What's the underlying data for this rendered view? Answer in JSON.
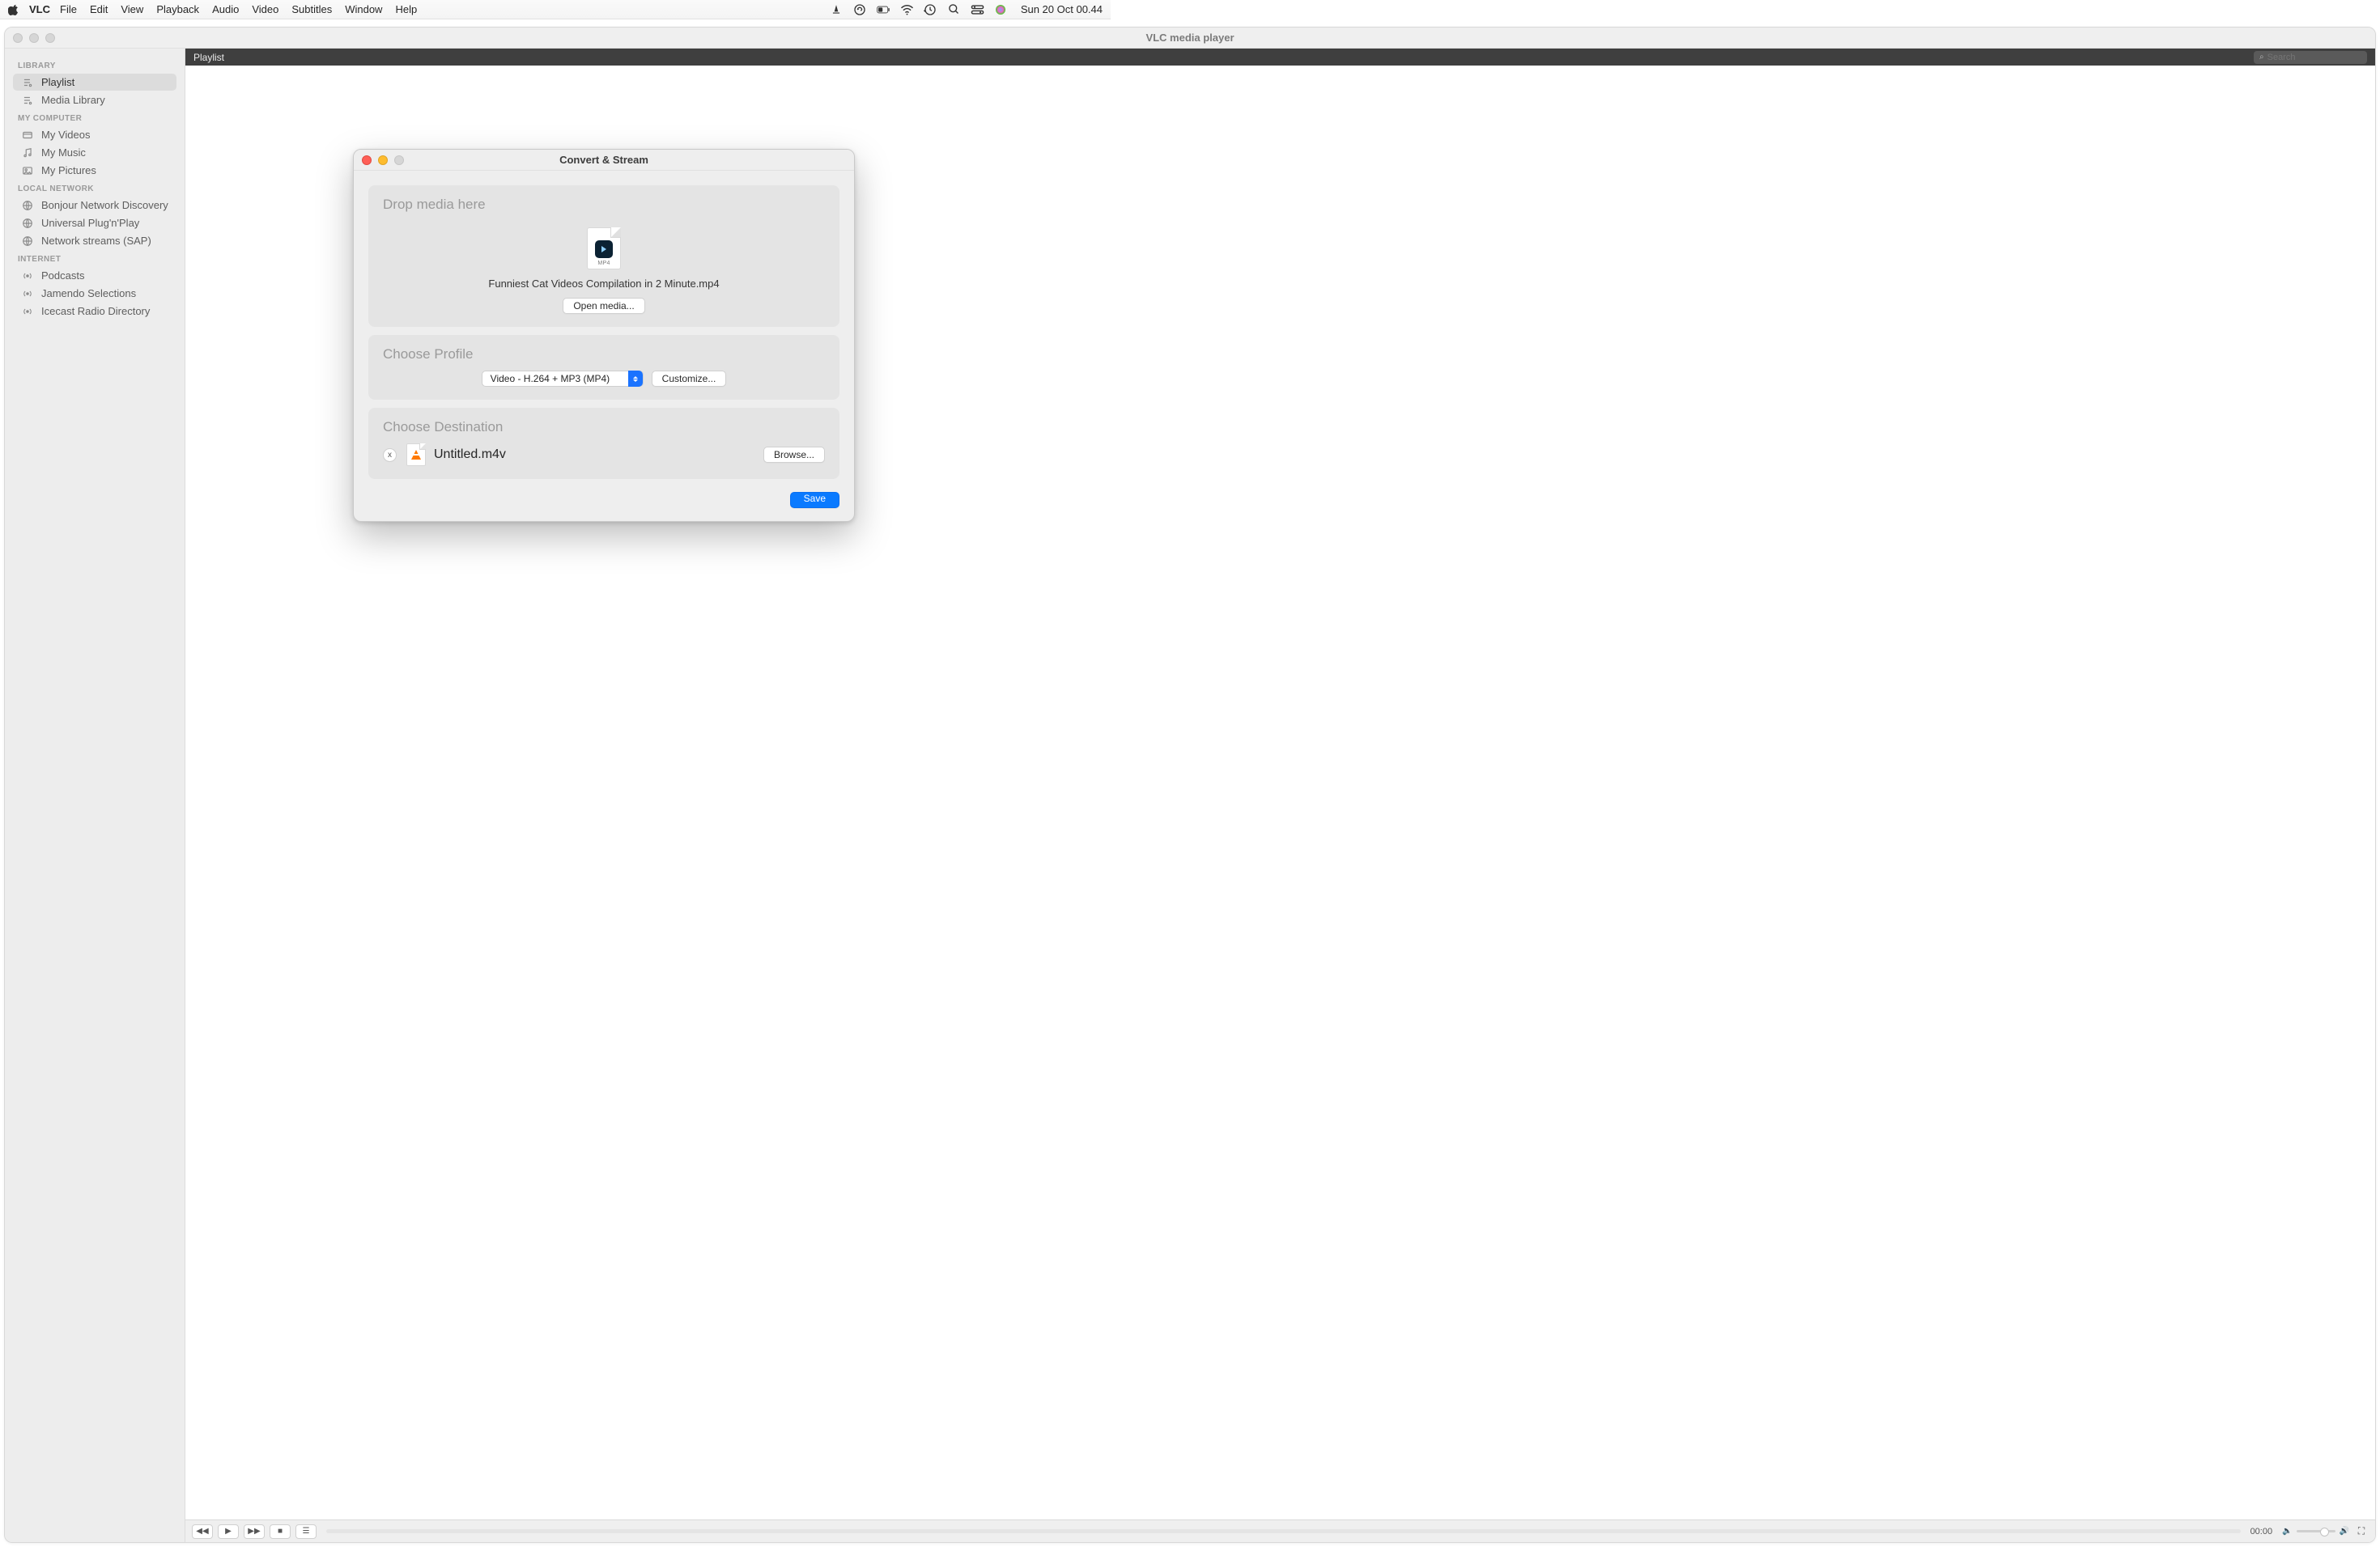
{
  "menubar": {
    "app": "VLC",
    "items": [
      "File",
      "Edit",
      "View",
      "Playback",
      "Audio",
      "Video",
      "Subtitles",
      "Window",
      "Help"
    ],
    "clock": "Sun 20 Oct  00.44"
  },
  "window": {
    "title": "VLC media player"
  },
  "sidebar": {
    "groups": [
      {
        "label": "LIBRARY",
        "items": [
          {
            "label": "Playlist",
            "icon": "playlist",
            "active": true
          },
          {
            "label": "Media Library",
            "icon": "playlist"
          }
        ]
      },
      {
        "label": "MY COMPUTER",
        "items": [
          {
            "label": "My Videos",
            "icon": "video"
          },
          {
            "label": "My Music",
            "icon": "music"
          },
          {
            "label": "My Pictures",
            "icon": "pictures"
          }
        ]
      },
      {
        "label": "LOCAL NETWORK",
        "items": [
          {
            "label": "Bonjour Network Discovery",
            "icon": "network"
          },
          {
            "label": "Universal Plug'n'Play",
            "icon": "network"
          },
          {
            "label": "Network streams (SAP)",
            "icon": "network"
          }
        ]
      },
      {
        "label": "INTERNET",
        "items": [
          {
            "label": "Podcasts",
            "icon": "broadcast"
          },
          {
            "label": "Jamendo Selections",
            "icon": "broadcast"
          },
          {
            "label": "Icecast Radio Directory",
            "icon": "broadcast"
          }
        ]
      }
    ]
  },
  "playlist": {
    "header": "Playlist",
    "search_placeholder": "Search"
  },
  "playbar": {
    "time": "00:00"
  },
  "modal": {
    "title": "Convert & Stream",
    "drop": {
      "heading": "Drop media here",
      "file_ext": "MP4",
      "file_name": "Funniest Cat Videos Compilation in 2 Minute.mp4",
      "open_label": "Open media..."
    },
    "profile": {
      "heading": "Choose Profile",
      "selected": "Video - H.264 + MP3 (MP4)",
      "customize_label": "Customize..."
    },
    "dest": {
      "heading": "Choose Destination",
      "x_label": "x",
      "file_name": "Untitled.m4v",
      "browse_label": "Browse..."
    },
    "save_label": "Save"
  }
}
